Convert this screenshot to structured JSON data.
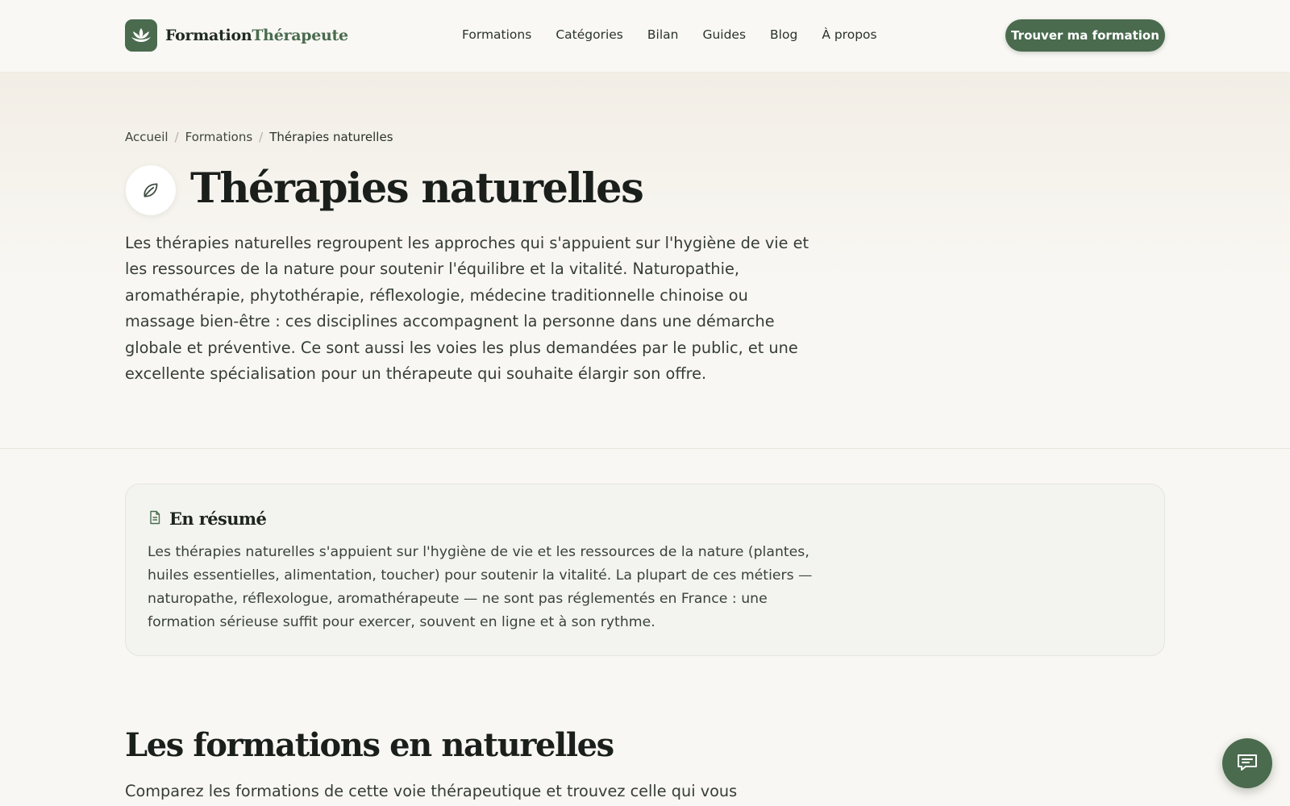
{
  "brand": {
    "name_part1": "Formation",
    "name_part2": "Thérapeute",
    "logo_icon": "lotus-icon"
  },
  "nav": {
    "items": [
      {
        "label": "Formations"
      },
      {
        "label": "Catégories"
      },
      {
        "label": "Bilan"
      },
      {
        "label": "Guides"
      },
      {
        "label": "Blog"
      },
      {
        "label": "À propos"
      }
    ],
    "cta_label": "Trouver ma formation"
  },
  "breadcrumb": {
    "home": "Accueil",
    "section": "Formations",
    "current": "Thérapies naturelles",
    "separator": "/"
  },
  "hero": {
    "icon": "leaf-icon",
    "title": "Thérapies naturelles",
    "intro": "Les thérapies naturelles regroupent les approches qui s'appuient sur l'hygiène de vie et les ressources de la nature pour soutenir l'équilibre et la vitalité. Naturopathie, aromathérapie, phytothérapie, réflexologie, médecine traditionnelle chinoise ou massage bien-être : ces disciplines accompagnent la personne dans une démarche globale et préventive. Ce sont aussi les voies les plus demandées par le public, et une excellente spécialisation pour un thérapeute qui souhaite élargir son offre."
  },
  "summary": {
    "icon": "document-icon",
    "title": "En résumé",
    "text": "Les thérapies naturelles s'appuient sur l'hygiène de vie et les ressources de la nature (plantes, huiles essentielles, alimentation, toucher) pour soutenir la vitalité. La plupart de ces métiers — naturopathe, réflexologue, aromathérapeute — ne sont pas réglementés en France : une formation sérieuse suffit pour exercer, souvent en ligne et à son rythme."
  },
  "formations_section": {
    "title": "Les formations en naturelles",
    "subtitle": "Comparez les formations de cette voie thérapeutique et trouvez celle qui vous"
  },
  "chat": {
    "icon": "chat-icon"
  },
  "colors": {
    "accent": "#4a6b4e",
    "background": "#f9f7f3",
    "card": "#f3f4f0",
    "heading": "#1a1f1b"
  }
}
